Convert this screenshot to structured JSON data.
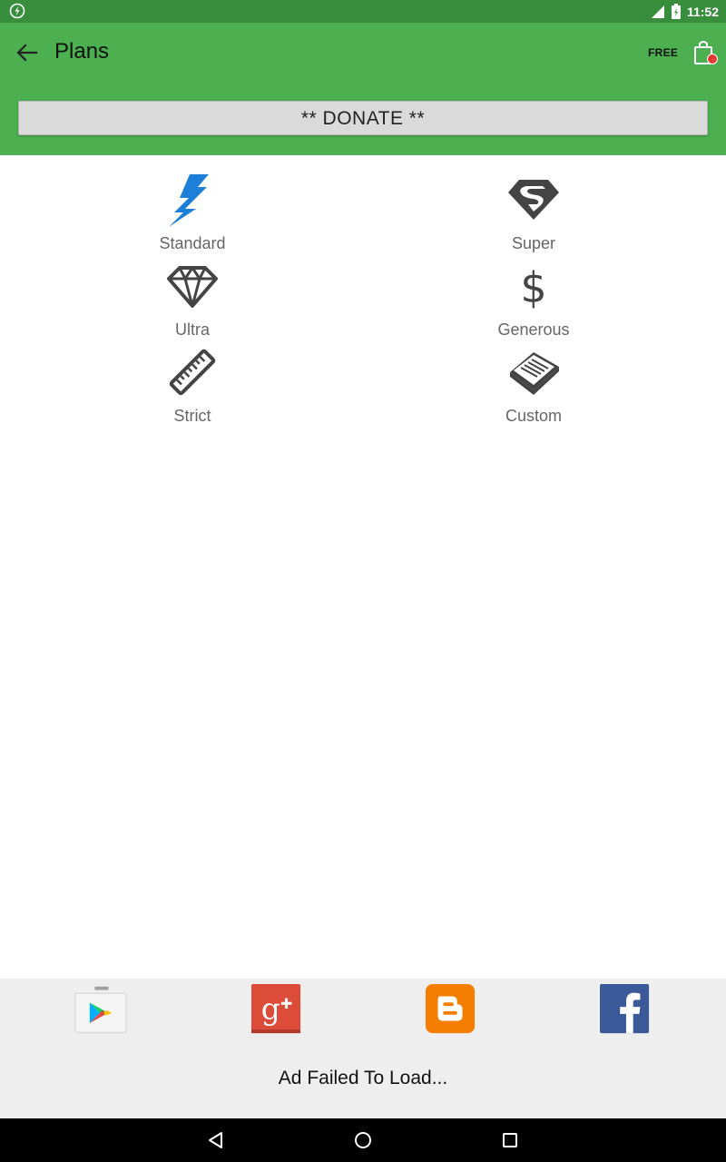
{
  "status": {
    "time": "11:52"
  },
  "appbar": {
    "title": "Plans",
    "free_label": "FREE"
  },
  "donate": {
    "label": "** DONATE **"
  },
  "plans": [
    {
      "label": "Standard",
      "icon": "lightning-icon",
      "color": "#1e7fd8"
    },
    {
      "label": "Super",
      "icon": "superman-shield-icon",
      "color": "#444444"
    },
    {
      "label": "Ultra",
      "icon": "diamond-icon",
      "color": "#444444"
    },
    {
      "label": "Generous",
      "icon": "dollar-icon",
      "color": "#444444"
    },
    {
      "label": "Strict",
      "icon": "ruler-icon",
      "color": "#444444"
    },
    {
      "label": "Custom",
      "icon": "notepad-icon",
      "color": "#444444"
    }
  ],
  "footer": {
    "social": [
      "google-play-icon",
      "google-plus-icon",
      "blogger-icon",
      "facebook-icon"
    ],
    "ad_text": "Ad Failed To Load..."
  },
  "colors": {
    "status_bar": "#388e3c",
    "app_bar": "#4caf50",
    "accent_blue": "#1e7fd8",
    "notification_dot": "#e53935"
  }
}
